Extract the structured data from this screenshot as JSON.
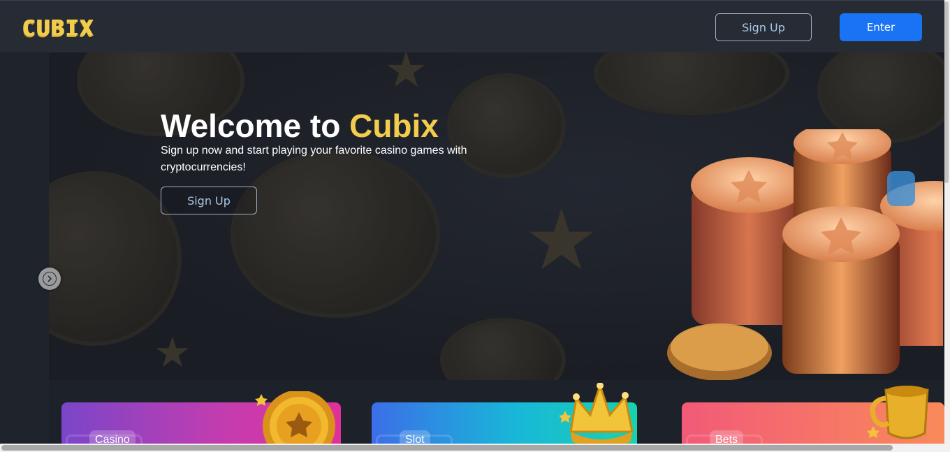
{
  "header": {
    "logo_text": "CUBIX",
    "signup_label": "Sign Up",
    "enter_label": "Enter"
  },
  "hero": {
    "title_prefix": "Welcome to ",
    "title_accent": "Cubix",
    "subtitle": "Sign up now and start playing your favorite casino games with cryptocurrencies!",
    "signup_label": "Sign Up"
  },
  "categories": [
    {
      "label": "Casino"
    },
    {
      "label": "Slot"
    },
    {
      "label": "Bets"
    }
  ],
  "colors": {
    "accent_yellow": "#f2cc4d",
    "primary_blue": "#1a73f5",
    "header_bg": "#262b34",
    "page_bg": "#1d2129"
  },
  "icons": {
    "slide_next": "chevron-right-icon"
  }
}
